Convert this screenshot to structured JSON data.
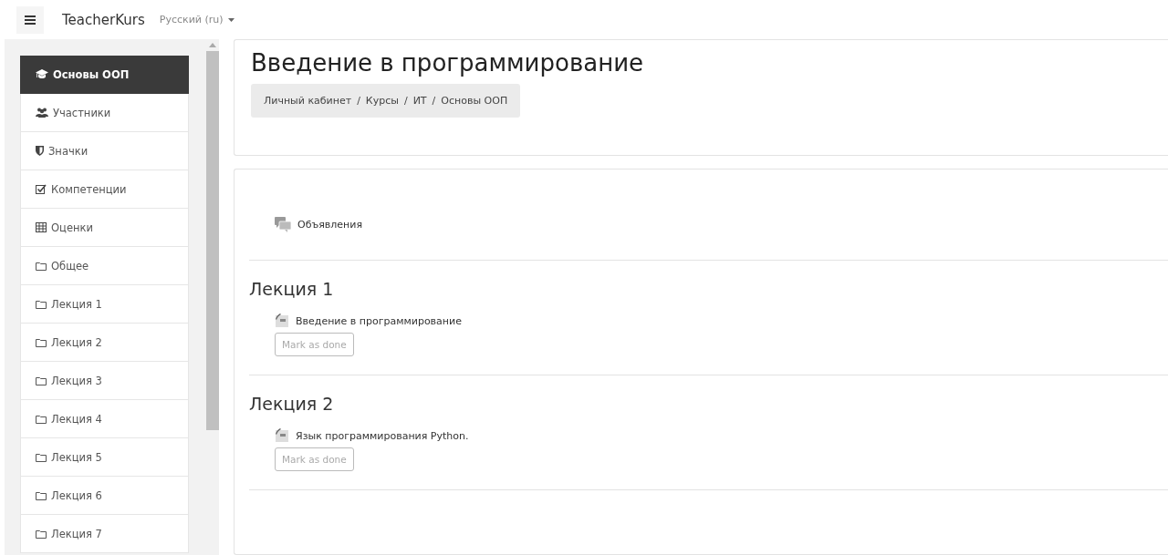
{
  "navbar": {
    "brand": "TeacherKurs",
    "language": "Русский (ru)"
  },
  "sidebar": {
    "items": [
      {
        "label": "Основы ООП",
        "kind": "course",
        "selected": true
      },
      {
        "label": "Участники",
        "kind": "participants",
        "selected": false
      },
      {
        "label": "Значки",
        "kind": "badges",
        "selected": false
      },
      {
        "label": "Компетенции",
        "kind": "competencies",
        "selected": false
      },
      {
        "label": "Оценки",
        "kind": "grades",
        "selected": false
      },
      {
        "label": "Общее",
        "kind": "section",
        "selected": false
      },
      {
        "label": "Лекция 1",
        "kind": "section",
        "selected": false
      },
      {
        "label": "Лекция 2",
        "kind": "section",
        "selected": false
      },
      {
        "label": "Лекция 3",
        "kind": "section",
        "selected": false
      },
      {
        "label": "Лекция 4",
        "kind": "section",
        "selected": false
      },
      {
        "label": "Лекция 5",
        "kind": "section",
        "selected": false
      },
      {
        "label": "Лекция 6",
        "kind": "section",
        "selected": false
      },
      {
        "label": "Лекция 7",
        "kind": "section",
        "selected": false
      }
    ]
  },
  "header": {
    "title": "Введение в программирование",
    "breadcrumb": [
      "Личный кабинет",
      "Курсы",
      "ИТ",
      "Основы ООП"
    ],
    "breadcrumb_separator": "/"
  },
  "sections": [
    {
      "activities": [
        {
          "kind": "forum",
          "label": "Объявления"
        }
      ]
    },
    {
      "title": "Лекция 1",
      "activities": [
        {
          "kind": "page",
          "label": "Введение в программирование",
          "button": "Mark as done"
        }
      ]
    },
    {
      "title": "Лекция 2",
      "activities": [
        {
          "kind": "page",
          "label": "Язык программирования Python.",
          "button": "Mark as done"
        }
      ]
    }
  ]
}
